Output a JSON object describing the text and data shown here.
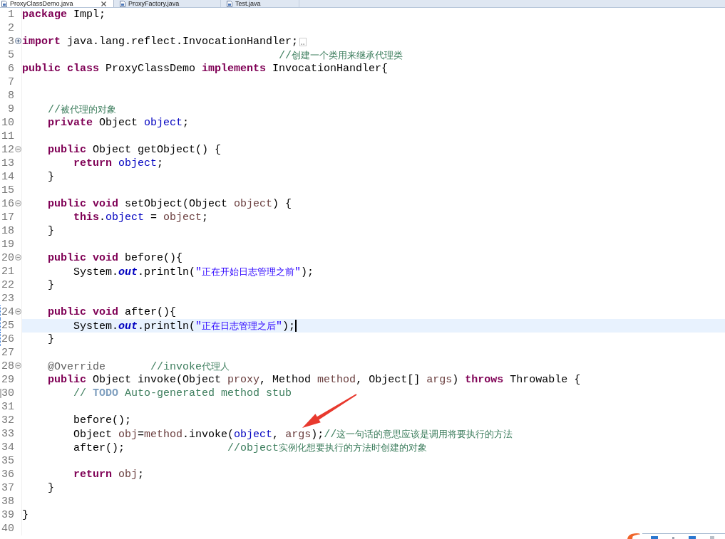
{
  "tabs": [
    {
      "label": "ProxyClassDemo.java",
      "selected": true
    },
    {
      "label": "ProxyFactory.java",
      "selected": false
    },
    {
      "label": "Test.java",
      "selected": false
    }
  ],
  "editor": {
    "lines": [
      {
        "number": "1",
        "current": false,
        "tokens": [
          {
            "kind": "keyword",
            "text": "package"
          },
          {
            "kind": "plain",
            "text": " Impl;"
          }
        ]
      },
      {
        "number": "2",
        "current": false
      },
      {
        "number": "3",
        "current": false,
        "fold_marker": {
          "collapsed": true
        },
        "tokens": [
          {
            "kind": "keyword",
            "text": "import"
          },
          {
            "kind": "plain",
            "text": " java.lang.reflect.InvocationHandler;"
          }
        ]
      },
      {
        "number": "5",
        "current": false,
        "tokens": [
          {
            "kind": "comment",
            "text": "                                        //创建一个类用来继承代理类"
          }
        ]
      },
      {
        "number": "6",
        "current": false,
        "tokens": [
          {
            "kind": "keyword",
            "text": "public class"
          },
          {
            "kind": "plain",
            "text": " ProxyClassDemo "
          },
          {
            "kind": "keyword",
            "text": "implements"
          },
          {
            "kind": "plain",
            "text": " InvocationHandler{"
          }
        ]
      },
      {
        "number": "7",
        "current": false
      },
      {
        "number": "8",
        "current": false
      },
      {
        "number": "9",
        "current": false,
        "tokens": [
          {
            "kind": "comment",
            "text": "    //被代理的对象"
          }
        ]
      },
      {
        "number": "10",
        "current": false,
        "tokens": [
          {
            "kind": "keyword",
            "text": "    private"
          },
          {
            "kind": "plain",
            "text": " Object "
          },
          {
            "kind": "field",
            "text": "object"
          },
          {
            "kind": "plain",
            "text": ";"
          }
        ]
      },
      {
        "number": "11",
        "current": false
      },
      {
        "number": "12",
        "current": false,
        "fold_marker": {
          "collapsed": false
        },
        "tokens": [
          {
            "kind": "keyword",
            "text": "    public"
          },
          {
            "kind": "plain",
            "text": " Object getObject() {"
          }
        ]
      },
      {
        "number": "13",
        "current": false,
        "tokens": [
          {
            "kind": "keyword",
            "text": "        return"
          },
          {
            "kind": "field",
            "text": " object"
          },
          {
            "kind": "plain",
            "text": ";"
          }
        ]
      },
      {
        "number": "14",
        "current": false,
        "tokens": [
          {
            "kind": "plain",
            "text": "    }"
          }
        ]
      },
      {
        "number": "15",
        "current": false
      },
      {
        "number": "16",
        "current": false,
        "fold_marker": {
          "collapsed": false
        },
        "tokens": [
          {
            "kind": "keyword",
            "text": "    public void"
          },
          {
            "kind": "plain",
            "text": " setObject(Object "
          },
          {
            "kind": "variable",
            "text": "object"
          },
          {
            "kind": "plain",
            "text": ") {"
          }
        ]
      },
      {
        "number": "17",
        "current": false,
        "tokens": [
          {
            "kind": "keyword",
            "text": "        this"
          },
          {
            "kind": "plain",
            "text": "."
          },
          {
            "kind": "field",
            "text": "object"
          },
          {
            "kind": "plain",
            "text": " = "
          },
          {
            "kind": "variable",
            "text": "object"
          },
          {
            "kind": "plain",
            "text": ";"
          }
        ]
      },
      {
        "number": "18",
        "current": false,
        "tokens": [
          {
            "kind": "plain",
            "text": "    }"
          }
        ]
      },
      {
        "number": "19",
        "current": false
      },
      {
        "number": "20",
        "current": false,
        "fold_marker": {
          "collapsed": false
        },
        "tokens": [
          {
            "kind": "keyword",
            "text": "    public void"
          },
          {
            "kind": "plain",
            "text": " before(){"
          }
        ]
      },
      {
        "number": "21",
        "current": false,
        "tokens": [
          {
            "kind": "plain",
            "text": "        System."
          },
          {
            "kind": "static",
            "text": "out"
          },
          {
            "kind": "plain",
            "text": ".println("
          },
          {
            "kind": "string",
            "text": "\"正在开始日志管理之前\""
          },
          {
            "kind": "plain",
            "text": ");"
          }
        ]
      },
      {
        "number": "22",
        "current": false,
        "tokens": [
          {
            "kind": "plain",
            "text": "    }"
          }
        ]
      },
      {
        "number": "23",
        "current": false
      },
      {
        "number": "24",
        "current": false,
        "fold_marker": {
          "collapsed": false
        },
        "change_marker": {
          "kind": "added"
        },
        "tokens": [
          {
            "kind": "keyword",
            "text": "    public void"
          },
          {
            "kind": "plain",
            "text": " after(){"
          }
        ]
      },
      {
        "number": "25",
        "current": true,
        "change_marker": {
          "kind": "added"
        },
        "tokens": [
          {
            "kind": "plain",
            "text": "        System."
          },
          {
            "kind": "static",
            "text": "out"
          },
          {
            "kind": "plain",
            "text": ".println("
          },
          {
            "kind": "string",
            "text": "\"正在日志管理之后\""
          },
          {
            "kind": "plain",
            "text": ");"
          }
        ]
      },
      {
        "number": "26",
        "current": false,
        "change_marker": {
          "kind": "added"
        },
        "tokens": [
          {
            "kind": "plain",
            "text": "    }"
          }
        ]
      },
      {
        "number": "27",
        "current": false
      },
      {
        "number": "28",
        "current": false,
        "fold_marker": {
          "collapsed": false
        },
        "tokens": [
          {
            "kind": "annotation",
            "text": "    @Override"
          },
          {
            "kind": "comment",
            "text": "       //invoke代理人"
          }
        ]
      },
      {
        "number": "29",
        "current": false,
        "tokens": [
          {
            "kind": "keyword",
            "text": "    public"
          },
          {
            "kind": "plain",
            "text": " Object invoke(Object "
          },
          {
            "kind": "variable",
            "text": "proxy"
          },
          {
            "kind": "plain",
            "text": ", Method "
          },
          {
            "kind": "variable",
            "text": "method"
          },
          {
            "kind": "plain",
            "text": ", Object[] "
          },
          {
            "kind": "variable",
            "text": "args"
          },
          {
            "kind": "plain",
            "text": ") "
          },
          {
            "kind": "keyword",
            "text": "throws"
          },
          {
            "kind": "plain",
            "text": " Throwable {"
          }
        ]
      },
      {
        "number": "30",
        "current": false,
        "change_marker": {
          "kind": "changed"
        },
        "tokens": [
          {
            "kind": "comment",
            "text": "        // "
          },
          {
            "kind": "task",
            "text": "TODO"
          },
          {
            "kind": "comment",
            "text": " Auto-generated method stub"
          }
        ]
      },
      {
        "number": "31",
        "current": false
      },
      {
        "number": "32",
        "current": false,
        "tokens": [
          {
            "kind": "plain",
            "text": "        before();"
          }
        ]
      },
      {
        "number": "33",
        "current": false,
        "tokens": [
          {
            "kind": "plain",
            "text": "        Object "
          },
          {
            "kind": "variable",
            "text": "obj"
          },
          {
            "kind": "plain",
            "text": "="
          },
          {
            "kind": "variable",
            "text": "method"
          },
          {
            "kind": "plain",
            "text": ".invoke("
          },
          {
            "kind": "field",
            "text": "object"
          },
          {
            "kind": "plain",
            "text": ", "
          },
          {
            "kind": "variable",
            "text": "args"
          },
          {
            "kind": "plain",
            "text": ");"
          },
          {
            "kind": "comment",
            "text": "//这一句话的意思应该是调用将要执行的方法"
          }
        ]
      },
      {
        "number": "34",
        "current": false,
        "tokens": [
          {
            "kind": "plain",
            "text": "        after();"
          },
          {
            "kind": "comment",
            "text": "                //object实例化想要执行的方法时创建的对象"
          }
        ]
      },
      {
        "number": "35",
        "current": false
      },
      {
        "number": "36",
        "current": false,
        "tokens": [
          {
            "kind": "keyword",
            "text": "        return"
          },
          {
            "kind": "variable",
            "text": " obj"
          },
          {
            "kind": "plain",
            "text": ";"
          }
        ]
      },
      {
        "number": "37",
        "current": false,
        "tokens": [
          {
            "kind": "plain",
            "text": "    }"
          }
        ]
      },
      {
        "number": "38",
        "current": false
      },
      {
        "number": "39",
        "current": false,
        "tokens": [
          {
            "kind": "plain",
            "text": "}"
          }
        ]
      },
      {
        "number": "40",
        "current": false
      }
    ]
  }
}
